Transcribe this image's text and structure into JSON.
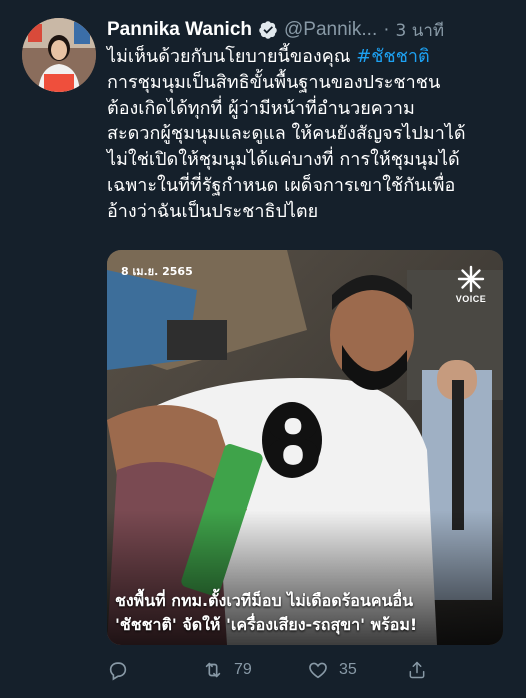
{
  "user": {
    "name": "Pannika Wanich",
    "handle": "@Pannik...",
    "time": "3 นาที",
    "separator": "·"
  },
  "tweet": {
    "line1_text": "ไม่เห็นด้วยกับนโยบายนี้ของคุณ ",
    "hashtag": "#ชัชชาติ",
    "body": "การชุมนุมเป็นสิทธิขั้นพื้นฐานของประชาชน\nต้องเกิดได้ทุกที่ ผู้ว่ามีหน้าที่อำนวยความ\nสะดวกผู้ชุมนุมและดูแล ให้คนยังสัญจรไปมาได้\nไม่ใช่เปิดให้ชุมนุมได้แค่บางที่ การให้ชุมนุมได้\nเฉพาะในที่ที่รัฐกำหนด เผด็จการเขาใช้กันเพื่อ\nอ้างว่าฉันเป็นประชาธิปไตย"
  },
  "media": {
    "date": "8 เม.ย. 2565",
    "logo_text": "VOICE",
    "shirt_number": "8",
    "caption_line1": "ชงพื้นที่ กทม.ตั้งเวทีม็อบ ไม่เดือดร้อนคนอื่น",
    "caption_line2": "'ชัชชาติ' จัดให้ 'เครื่องเสียง-รถสุขา' พร้อม!"
  },
  "actions": {
    "reply_count": "",
    "retweet_count": "79",
    "like_count": "35"
  },
  "colors": {
    "background": "#15202b",
    "secondary_text": "#8899a6",
    "hashtag": "#1da1f2",
    "verified": "#1da1f2"
  },
  "icons": [
    "verified-badge-icon",
    "reply-icon",
    "retweet-icon",
    "like-icon",
    "share-icon",
    "voice-logo-icon"
  ]
}
